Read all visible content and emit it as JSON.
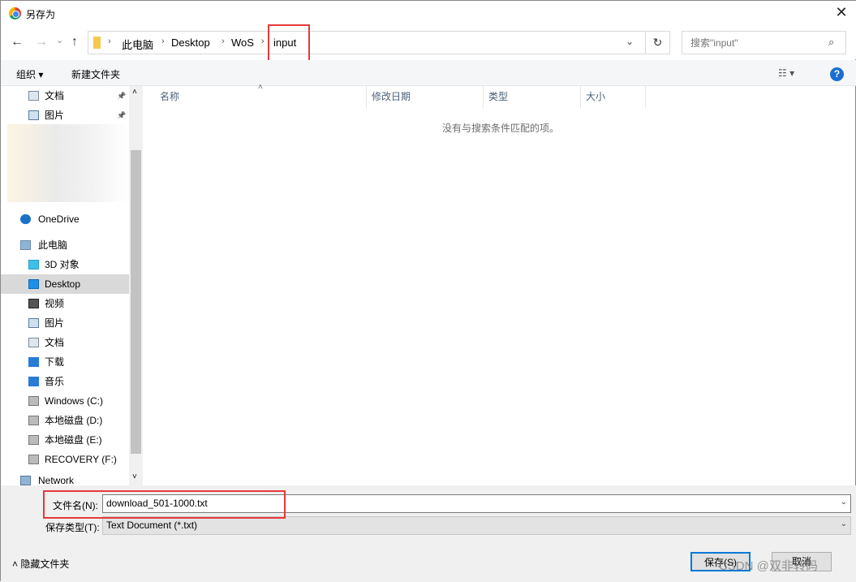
{
  "window": {
    "title": "另存为",
    "close": "✕"
  },
  "nav": {
    "back": "←",
    "forward": "→",
    "recent": "⌄",
    "up": "↑",
    "refresh": "↻",
    "breadcrumb": [
      "此电脑",
      "Desktop",
      "WoS",
      "input"
    ],
    "dropdown": "⌄",
    "search_placeholder": "搜索\"input\""
  },
  "toolbar": {
    "organize": "组织 ▾",
    "new_folder": "新建文件夹",
    "view": "☷ ▾",
    "help": "?"
  },
  "sidebar": {
    "items": [
      {
        "label": "文档",
        "icon": "documents-icon",
        "pinned": true
      },
      {
        "label": "图片",
        "icon": "pictures-icon",
        "pinned": true
      },
      {
        "label": "OneDrive",
        "icon": "onedrive-icon"
      },
      {
        "label": "此电脑",
        "icon": "this-pc-icon"
      },
      {
        "label": "3D 对象",
        "icon": "3d-objects-icon"
      },
      {
        "label": "Desktop",
        "icon": "desktop-icon",
        "selected": true
      },
      {
        "label": "视频",
        "icon": "videos-icon"
      },
      {
        "label": "图片",
        "icon": "pictures-icon"
      },
      {
        "label": "文档",
        "icon": "documents-icon"
      },
      {
        "label": "下载",
        "icon": "downloads-icon"
      },
      {
        "label": "音乐",
        "icon": "music-icon"
      },
      {
        "label": "Windows (C:)",
        "icon": "drive-icon"
      },
      {
        "label": "本地磁盘 (D:)",
        "icon": "drive-icon"
      },
      {
        "label": "本地磁盘 (E:)",
        "icon": "drive-icon"
      },
      {
        "label": "RECOVERY (F:)",
        "icon": "drive-icon"
      },
      {
        "label": "Network",
        "icon": "network-icon"
      }
    ]
  },
  "list": {
    "columns": [
      "名称",
      "修改日期",
      "类型",
      "大小"
    ],
    "empty_message": "没有与搜索条件匹配的项。"
  },
  "form": {
    "filename_label": "文件名(N):",
    "filename_value": "download_501-1000.txt",
    "filetype_label": "保存类型(T):",
    "filetype_value": "Text Document (*.txt)",
    "hide_folders": "隐藏文件夹",
    "save": "保存(S)",
    "cancel": "取消"
  },
  "watermark": "CSDN @双非转码",
  "colors": {
    "highlight": "#e8393a",
    "selected": "#d9d9d9",
    "accent": "#0078d7"
  }
}
